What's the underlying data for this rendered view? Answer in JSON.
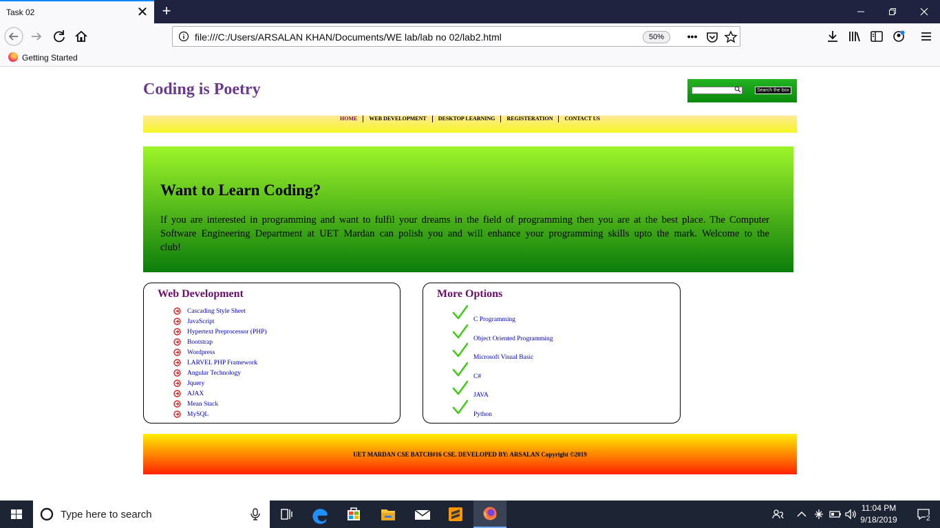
{
  "browser": {
    "tab_title": "Task 02",
    "tab_close": "✕",
    "new_tab": "+",
    "url": "file:///C:/Users/ARSALAN KHAN/Documents/WE lab/lab no 02/lab2.html",
    "zoom": "50%",
    "url_more": "•••",
    "bookmark": "Getting Started"
  },
  "site": {
    "title": "Coding is Poetry",
    "search_button": "Search the box",
    "menu": [
      "HOME",
      "WEB DEVELOPMENT",
      "DESKTOP LEARNING",
      "REGISTERATION",
      "CONTACT US"
    ],
    "hero": {
      "heading": "Want to Learn Coding?",
      "text": "If you are interested in programming and want to fulfil your dreams in the field of programming then you are at the best place. The Computer Software Engineering Department at UET Mardan can polish you and will enhance your programming skills upto the mark. Welcome to the club!"
    },
    "web_dev": {
      "title": "Web Development",
      "items": [
        "Cascading Style Sheet",
        "JavaScript",
        "Hypertext Preprocessor (PHP)",
        "Bootstrap",
        "Wordpress",
        "LARVEL PHP Framework",
        "Angular Technology",
        "Jquery",
        "AJAX",
        "Mean Stack",
        "MySQL"
      ]
    },
    "more_options": {
      "title": "More Options",
      "items": [
        "C Programming",
        "Object Oriented Programming",
        "Microsoft Visual Basic",
        "C#",
        "JAVA",
        "Python"
      ]
    },
    "footer": "UET MARDAN CSE BATCH#16 CSE. DEVELOPED BY: ARSALAN Copyright ©2019"
  },
  "taskbar": {
    "search_placeholder": "Type here to search",
    "time": "11:04 PM",
    "date": "9/18/2019",
    "notifications": "2"
  },
  "colors": {
    "title": "#6b3a8e",
    "link": "#0000cc",
    "box_title": "#6b0f6b",
    "active_menu": "#800080"
  }
}
